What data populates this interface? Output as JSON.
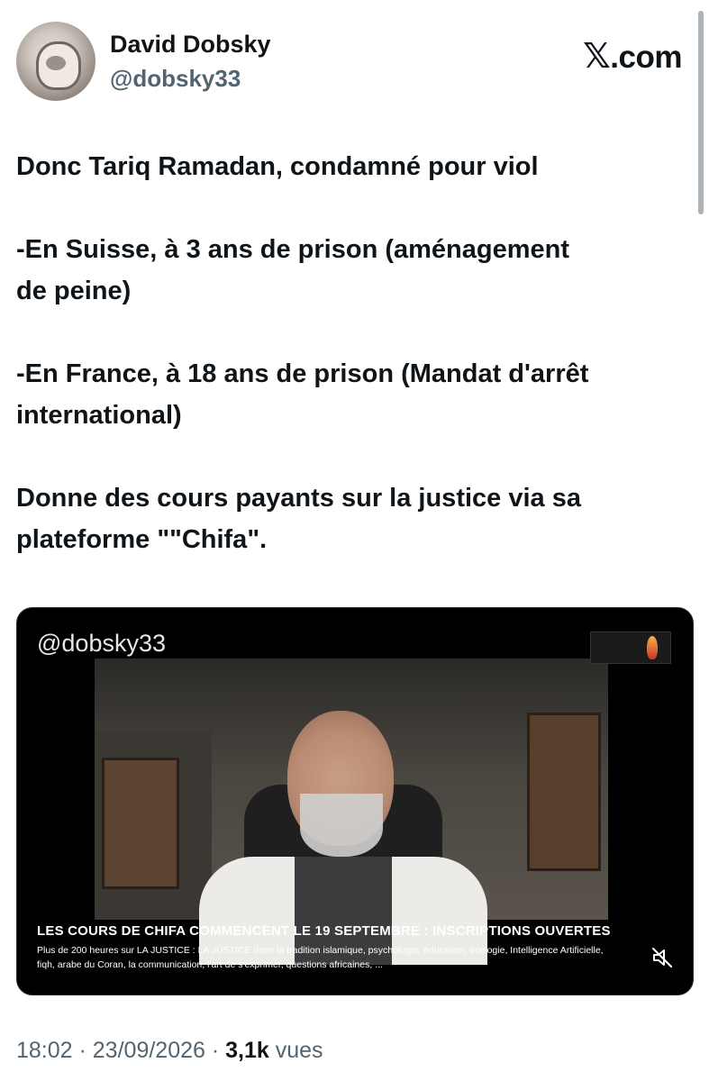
{
  "author": {
    "name": "David Dobsky",
    "handle": "@dobsky33"
  },
  "brand": {
    "site_label": ".com",
    "site_mark": "𝕏"
  },
  "tweet": {
    "line1": "Donc Tariq Ramadan, condamné pour viol",
    "line2a": "-En Suisse, à 3 ans de prison (aménagement",
    "line2b": "de peine)",
    "line3a": "-En France, à 18 ans de prison (Mandat d'arrêt",
    "line3b": "international)",
    "line4a": "Donne des cours payants sur la justice via sa",
    "line4b": "plateforme \"\"Chifa\"."
  },
  "media": {
    "watermark": "@dobsky33",
    "caption_title": "LES COURS DE CHIFA COMMENCENT LE 19 SEPTEMBRE : INSCRIPTIONS OUVERTES",
    "caption_line1": "Plus de 200 heures sur LA JUSTICE : LA JUSTICE dans la tradition islamique, psychologie, éducation, écologie, Intelligence Artificielle,",
    "caption_line2": "fiqh, arabe du Coran, la communication, l'art de s'exprimer, questions africaines, ...",
    "mute_icon": "speaker-muted-icon"
  },
  "meta": {
    "time": "18:02",
    "sep1": " · ",
    "date": "23/09/2026",
    "sep2": " · ",
    "views_count": "3,1k",
    "views_label": " vues"
  },
  "colors": {
    "text": "#0f1419",
    "secondary": "#536471",
    "media_bg": "#000000"
  }
}
